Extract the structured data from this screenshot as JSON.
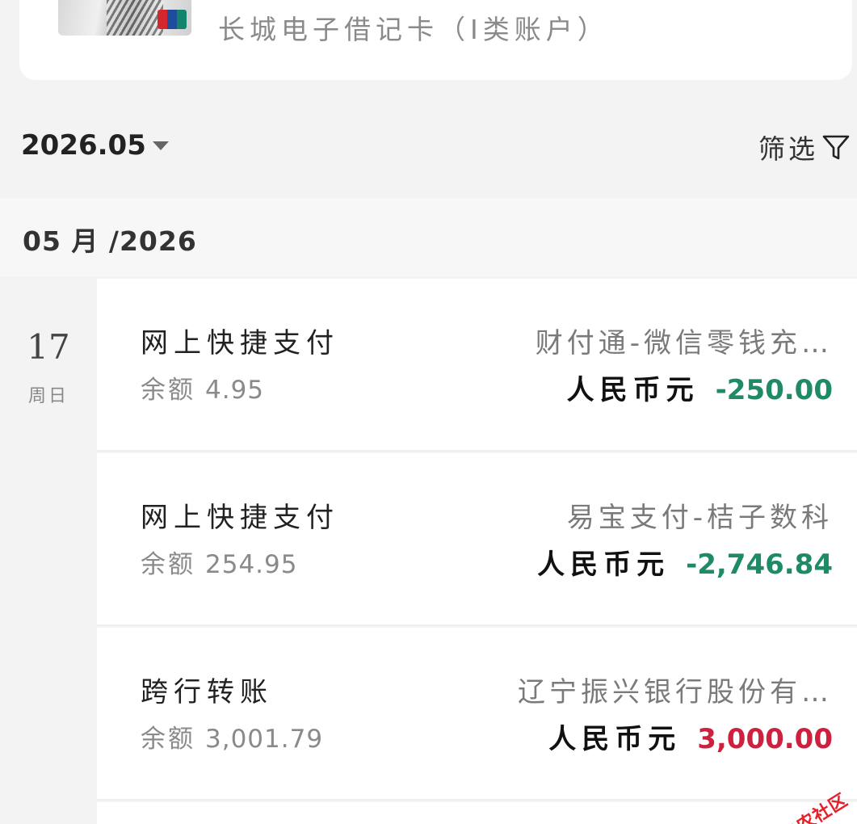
{
  "account": {
    "card_name": "长城电子借记卡（Ⅰ类账户）"
  },
  "toolbar": {
    "month": "2026.05",
    "filter_label": "筛选"
  },
  "section": {
    "month_header": "05 月 /2026"
  },
  "day": {
    "number": "17",
    "weekday": "周日"
  },
  "balance_label": "余额",
  "transactions": [
    {
      "type": "网上快捷支付",
      "balance": "4.95",
      "merchant": "财付通-微信零钱充…",
      "currency": "人民币元",
      "amount": "-250.00"
    },
    {
      "type": "网上快捷支付",
      "balance": "254.95",
      "merchant": "易宝支付-桔子数科",
      "currency": "人民币元",
      "amount": "-2,746.84"
    },
    {
      "type": "跨行转账",
      "balance": "3,001.79",
      "merchant": "辽宁振兴银行股份有…",
      "currency": "人民币元",
      "amount": "3,000.00"
    }
  ],
  "watermark": {
    "text": "卡农社区"
  },
  "colors": {
    "debit": "#1e8a66",
    "credit": "#cc2240"
  }
}
